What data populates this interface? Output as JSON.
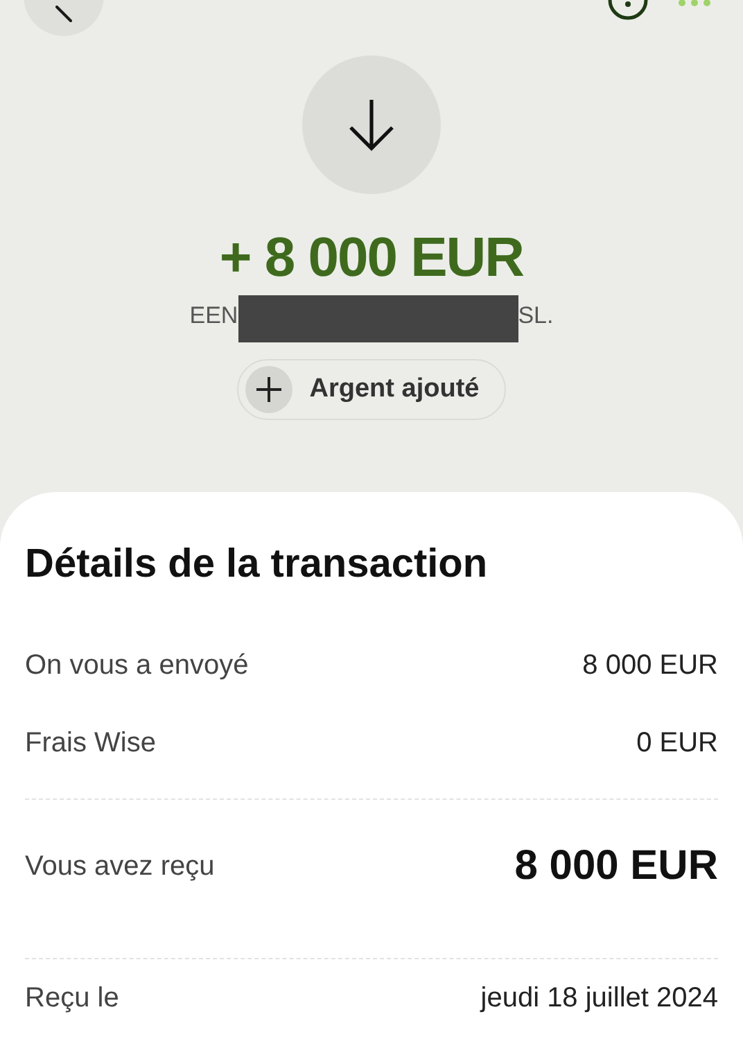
{
  "header": {
    "amount": "+ 8 000 EUR",
    "sender_start": "EEN",
    "sender_end": "SL.",
    "chip": {
      "label": "Argent ajouté"
    }
  },
  "details": {
    "title": "Détails de la transaction",
    "groups": [
      [
        {
          "kind": "plain",
          "label": "On vous a envoyé",
          "value": "8 000 EUR"
        },
        {
          "kind": "plain",
          "label": "Frais Wise",
          "value": "0 EUR"
        }
      ],
      [
        {
          "kind": "total",
          "label": "Vous avez reçu",
          "value": "8 000 EUR"
        }
      ],
      [
        {
          "kind": "plain",
          "label": "Reçu le",
          "value": "jeudi 18 juillet 2024"
        }
      ]
    ]
  }
}
